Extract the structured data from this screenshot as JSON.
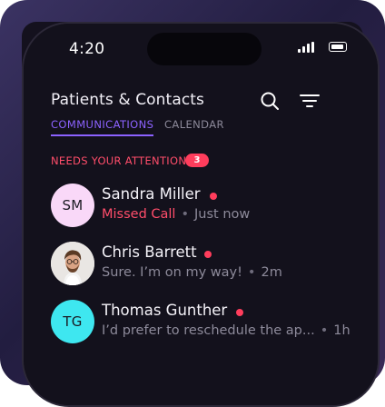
{
  "status_bar": {
    "time": "4:20"
  },
  "header": {
    "title": "Patients & Contacts"
  },
  "tabs": [
    {
      "label": "COMMUNICATIONS",
      "active": true
    },
    {
      "label": "CALENDAR",
      "active": false
    }
  ],
  "section": {
    "label": "NEEDS YOUR ATTENTION",
    "count": "3"
  },
  "contacts": [
    {
      "name": "Sandra Miller",
      "initials": "SM",
      "avatar_color": "#f9d8f8",
      "preview": "Missed Call",
      "preview_is_missed_call": true,
      "time": "Just now",
      "unread": true
    },
    {
      "name": "Chris Barrett",
      "initials": "",
      "avatar_type": "photo",
      "preview": "Sure. I’m on my way!",
      "time": "2m",
      "unread": true
    },
    {
      "name": "Thomas Gunther",
      "initials": "TG",
      "avatar_color": "#3ee7f0",
      "preview": "I’d prefer to reschedule the ap...",
      "time": "1h",
      "unread": true
    }
  ],
  "colors": {
    "accent": "#8c62ff",
    "alert": "#ff3d5c",
    "background": "#13111c"
  }
}
